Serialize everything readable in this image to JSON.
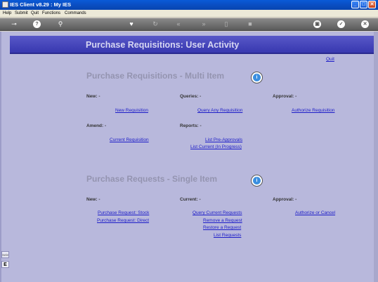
{
  "window": {
    "title": "IES Client v8.29 : My IES",
    "minimize": "_",
    "maximize": "□",
    "close": "✕"
  },
  "menu": [
    "Help",
    "Submit",
    "Quit",
    "Functions",
    "Commands"
  ],
  "toolbar": {
    "icons": [
      "key-icon",
      "help-icon",
      "search-icon",
      "heart-icon",
      "refresh-icon",
      "back-icon",
      "forward-icon",
      "document-icon",
      "stop-icon",
      "lock-icon",
      "check-icon",
      "close-icon"
    ]
  },
  "page": {
    "banner_title": "Purchase Requisitions: User Activity",
    "quit_link": "Quit"
  },
  "multi": {
    "title": "Purchase Requisitions - Multi Item",
    "new_label": "New: -",
    "queries_label": "Queries: -",
    "approval_label": "Approval: -",
    "amend_label": "Amend: -",
    "reports_label": "Reports: -",
    "new_requisition": "New Requisition",
    "query_any": "Query Any Requisition",
    "authorize": "Authorize Requisition",
    "current_requisition": "Current Requisition",
    "list_pre_approvals": "List Pre-Approvals",
    "list_current": "List Current (In Progress)"
  },
  "single": {
    "title": "Purchase Requests - Single Item",
    "new_label": "New: -",
    "current_label": "Current: -",
    "approval_label": "Approval: -",
    "request_stock": "Purchase Request: Stock",
    "request_direct": "Purchase Request: Direct",
    "query_current": "Query Current Requests",
    "remove": "Remove a Request",
    "restore": "Restore a Request",
    "list": "List Requests",
    "authorize_cancel": "Authorize or Cancel"
  },
  "left_edge": {
    "top_label": "Sele",
    "bottom_label": "E"
  },
  "colors": {
    "background": "#b8b8dc",
    "banner": "#4848bc",
    "link": "#1c1cc8",
    "section_title": "#9494b0"
  }
}
